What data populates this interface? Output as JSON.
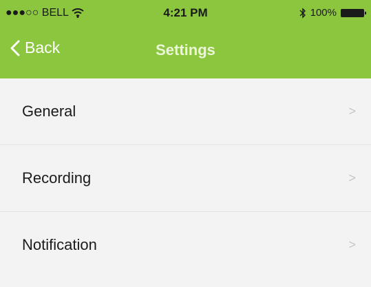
{
  "status_bar": {
    "carrier": "●●●○○ BELL",
    "wifi_icon": "wifi-icon",
    "time": "4:21 PM",
    "bluetooth_icon": "bluetooth-icon",
    "battery_percent": "100%",
    "battery_icon": "battery-icon"
  },
  "nav": {
    "back_label": "Back",
    "title": "Settings",
    "accent_color": "#8cc63f"
  },
  "settings": {
    "items": [
      {
        "label": "General",
        "icon": "chevron-right-icon"
      },
      {
        "label": "Recording",
        "icon": "chevron-right-icon"
      },
      {
        "label": "Notification",
        "icon": "chevron-right-icon"
      }
    ]
  }
}
